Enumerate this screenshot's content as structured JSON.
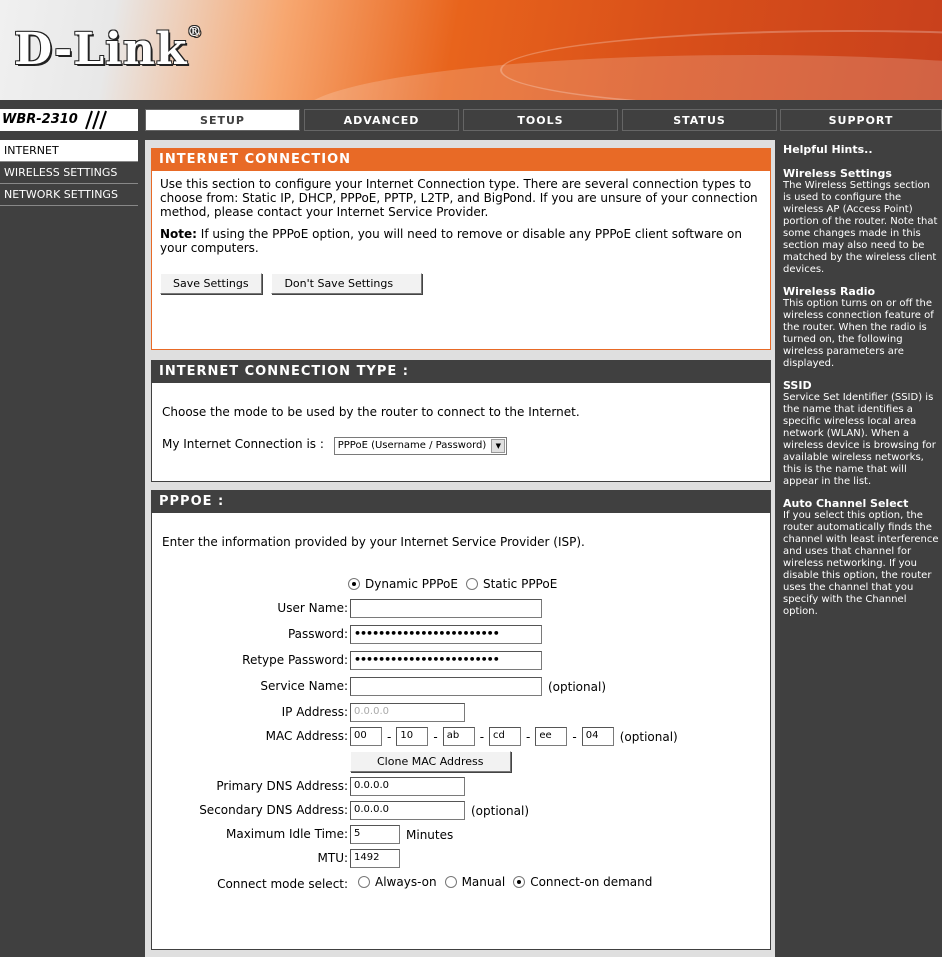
{
  "header": {
    "logo": "D-Link",
    "logo_mark": "®",
    "model": "WBR-2310"
  },
  "tabs": [
    "SETUP",
    "ADVANCED",
    "TOOLS",
    "STATUS"
  ],
  "support_tab": "SUPPORT",
  "nav": [
    "INTERNET",
    "WIRELESS SETTINGS",
    "NETWORK SETTINGS"
  ],
  "internet_connection": {
    "title": "INTERNET CONNECTION",
    "intro": "Use this section to configure your Internet Connection type. There are several connection types to choose from: Static IP, DHCP, PPPoE, PPTP, L2TP, and BigPond. If you are unsure of your connection method, please contact your Internet Service Provider.",
    "note_label": "Note:",
    "note_text": " If using the PPPoE option, you will need to remove or disable any PPPoE client software on your computers.",
    "save_label": "Save Settings",
    "dont_save_label": "Don't Save Settings"
  },
  "connection_type": {
    "title": "INTERNET CONNECTION TYPE :",
    "desc": "Choose the mode to be used by the router to connect to the Internet.",
    "label": "My Internet Connection is :",
    "selected": "PPPoE (Username / Password)"
  },
  "pppoe": {
    "title": "PPPOE :",
    "desc": "Enter the information provided by your Internet Service Provider (ISP).",
    "mode_dynamic": "Dynamic PPPoE",
    "mode_static": "Static PPPoE",
    "user_name_label": "User Name",
    "user_name_value": "",
    "password_label": "Password",
    "password_value": "••••••••••••••••••••••••",
    "retype_label": "Retype Password",
    "retype_value": "••••••••••••••••••••••••",
    "service_name_label": "Service Name",
    "service_name_value": "",
    "optional": "(optional)",
    "ip_label": "IP Address",
    "ip_value": "0.0.0.0",
    "mac_label": "MAC Address",
    "mac": [
      "00",
      "10",
      "ab",
      "cd",
      "ee",
      "04"
    ],
    "clone_mac_label": "Clone MAC Address",
    "primary_dns_label": "Primary DNS Address",
    "primary_dns_value": "0.0.0.0",
    "secondary_dns_label": "Secondary DNS Address",
    "secondary_dns_value": "0.0.0.0",
    "idle_label": "Maximum Idle Time",
    "idle_value": "5",
    "idle_unit": "Minutes",
    "mtu_label": "MTU",
    "mtu_value": "1492",
    "connect_label": "Connect mode select",
    "connect_always": "Always-on",
    "connect_manual": "Manual",
    "connect_demand": "Connect-on demand",
    "colon": ":",
    "dash": "-"
  },
  "help": {
    "title": "Helpful Hints..",
    "items": [
      {
        "heading": "Wireless Settings",
        "text": "The Wireless Settings section is used to configure the wireless AP (Access Point) portion of the router. Note that some changes made in this section may also need to be matched by the wireless client devices."
      },
      {
        "heading": "Wireless Radio",
        "text": "This option turns on or off the wireless connection feature of the router. When the radio is turned on, the following wireless parameters are displayed."
      },
      {
        "heading": "SSID",
        "text": "Service Set Identifier (SSID) is the name that identifies a specific wireless local area network (WLAN). When a wireless device is browsing for available wireless networks, this is the name that will appear in the list."
      },
      {
        "heading": "Auto Channel Select",
        "text": "If you select this option, the router automatically finds the channel with least interference and uses that channel for wireless networking. If you disable this option, the router uses the channel that you specify with the Channel option."
      }
    ]
  }
}
